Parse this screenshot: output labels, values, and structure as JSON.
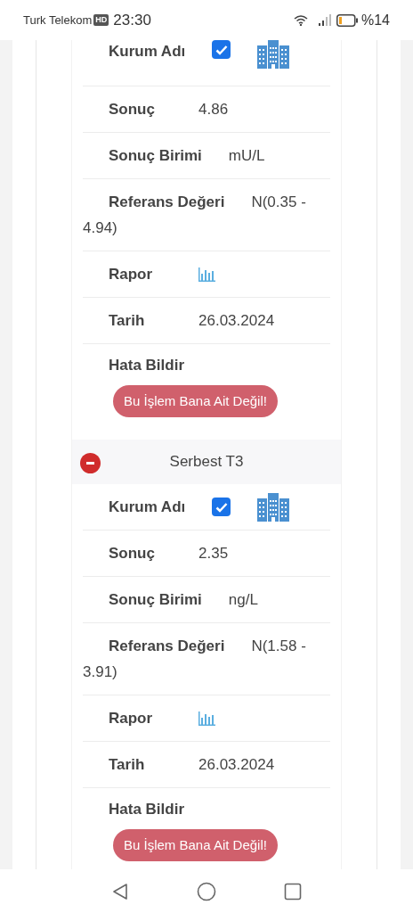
{
  "status_bar": {
    "carrier": "Turk Telekom",
    "network_badge": "HD",
    "time": "23:30",
    "battery": "%14"
  },
  "results": [
    {
      "rows": [
        {
          "kind": "institution",
          "label": "Kurum Adı",
          "checked": true
        },
        {
          "kind": "text",
          "label": "Sonuç",
          "value": "4.86"
        },
        {
          "kind": "text",
          "label": "Sonuç Birimi",
          "value": "mU/L"
        },
        {
          "kind": "text",
          "label": "Referans Değeri",
          "value": "N(0.35 - 4.94)"
        },
        {
          "kind": "chart",
          "label": "Rapor"
        },
        {
          "kind": "text",
          "label": "Tarih",
          "value": "26.03.2024"
        },
        {
          "kind": "button",
          "label": "Hata Bildir",
          "button": "Bu İşlem Bana Ait Değil!"
        }
      ]
    },
    {
      "title": "Serbest T3",
      "expanded": true,
      "rows": [
        {
          "kind": "institution",
          "label": "Kurum Adı",
          "checked": true
        },
        {
          "kind": "text",
          "label": "Sonuç",
          "value": "2.35"
        },
        {
          "kind": "text",
          "label": "Sonuç Birimi",
          "value": "ng/L"
        },
        {
          "kind": "text",
          "label": "Referans Değeri",
          "value": "N(1.58 - 3.91)"
        },
        {
          "kind": "chart",
          "label": "Rapor"
        },
        {
          "kind": "text",
          "label": "Tarih",
          "value": "26.03.2024"
        },
        {
          "kind": "button",
          "label": "Hata Bildir",
          "button": "Bu İşlem Bana Ait Değil!"
        }
      ]
    }
  ]
}
